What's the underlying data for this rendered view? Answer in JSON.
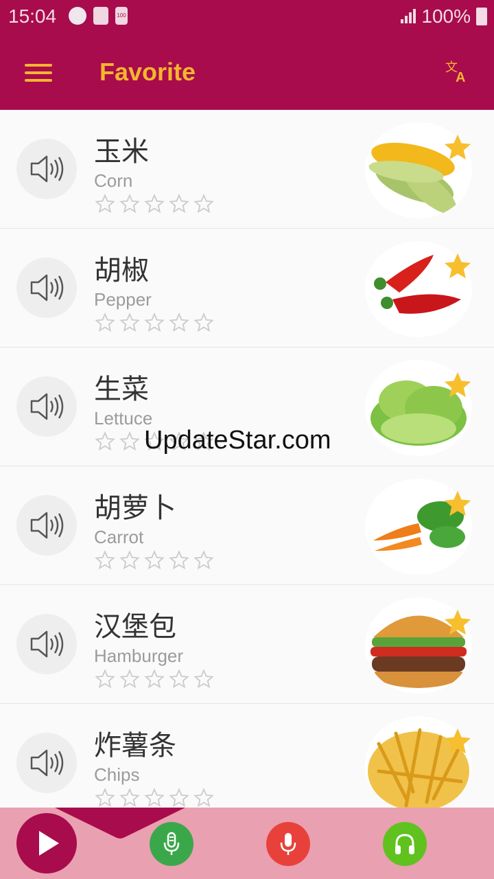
{
  "status_bar": {
    "time": "15:04",
    "battery_text": "100%",
    "left_icons": [
      "app-notification-icon",
      "clock-icon",
      "battery-saver-icon"
    ],
    "badge_text": "100"
  },
  "app_bar": {
    "title": "Favorite",
    "menu_icon": "hamburger-menu-icon",
    "action_icon": "translate-icon"
  },
  "items": [
    {
      "chinese": "玉米",
      "english": "Corn",
      "rating": 0,
      "favorite": true,
      "image": "corn"
    },
    {
      "chinese": "胡椒",
      "english": "Pepper",
      "rating": 0,
      "favorite": true,
      "image": "red-pepper"
    },
    {
      "chinese": "生菜",
      "english": "Lettuce",
      "rating": 0,
      "favorite": true,
      "image": "lettuce"
    },
    {
      "chinese": "胡萝卜",
      "english": "Carrot",
      "rating": 0,
      "favorite": true,
      "image": "carrot"
    },
    {
      "chinese": "汉堡包",
      "english": "Hamburger",
      "rating": 0,
      "favorite": true,
      "image": "hamburger"
    },
    {
      "chinese": "炸薯条",
      "english": "Chips",
      "rating": 0,
      "favorite": true,
      "image": "chips"
    }
  ],
  "watermark": "UpdateStar.com",
  "bottom_bar": {
    "buttons": [
      "play-icon",
      "microphone-icon",
      "record-icon",
      "headphones-icon"
    ]
  },
  "colors": {
    "primary": "#a80c4c",
    "accent": "#f5b52f",
    "bottom_bar": "#e9a0b0",
    "mic_green": "#3aa84a",
    "record_red": "#e8413b",
    "headphones_green": "#5fc21f"
  }
}
